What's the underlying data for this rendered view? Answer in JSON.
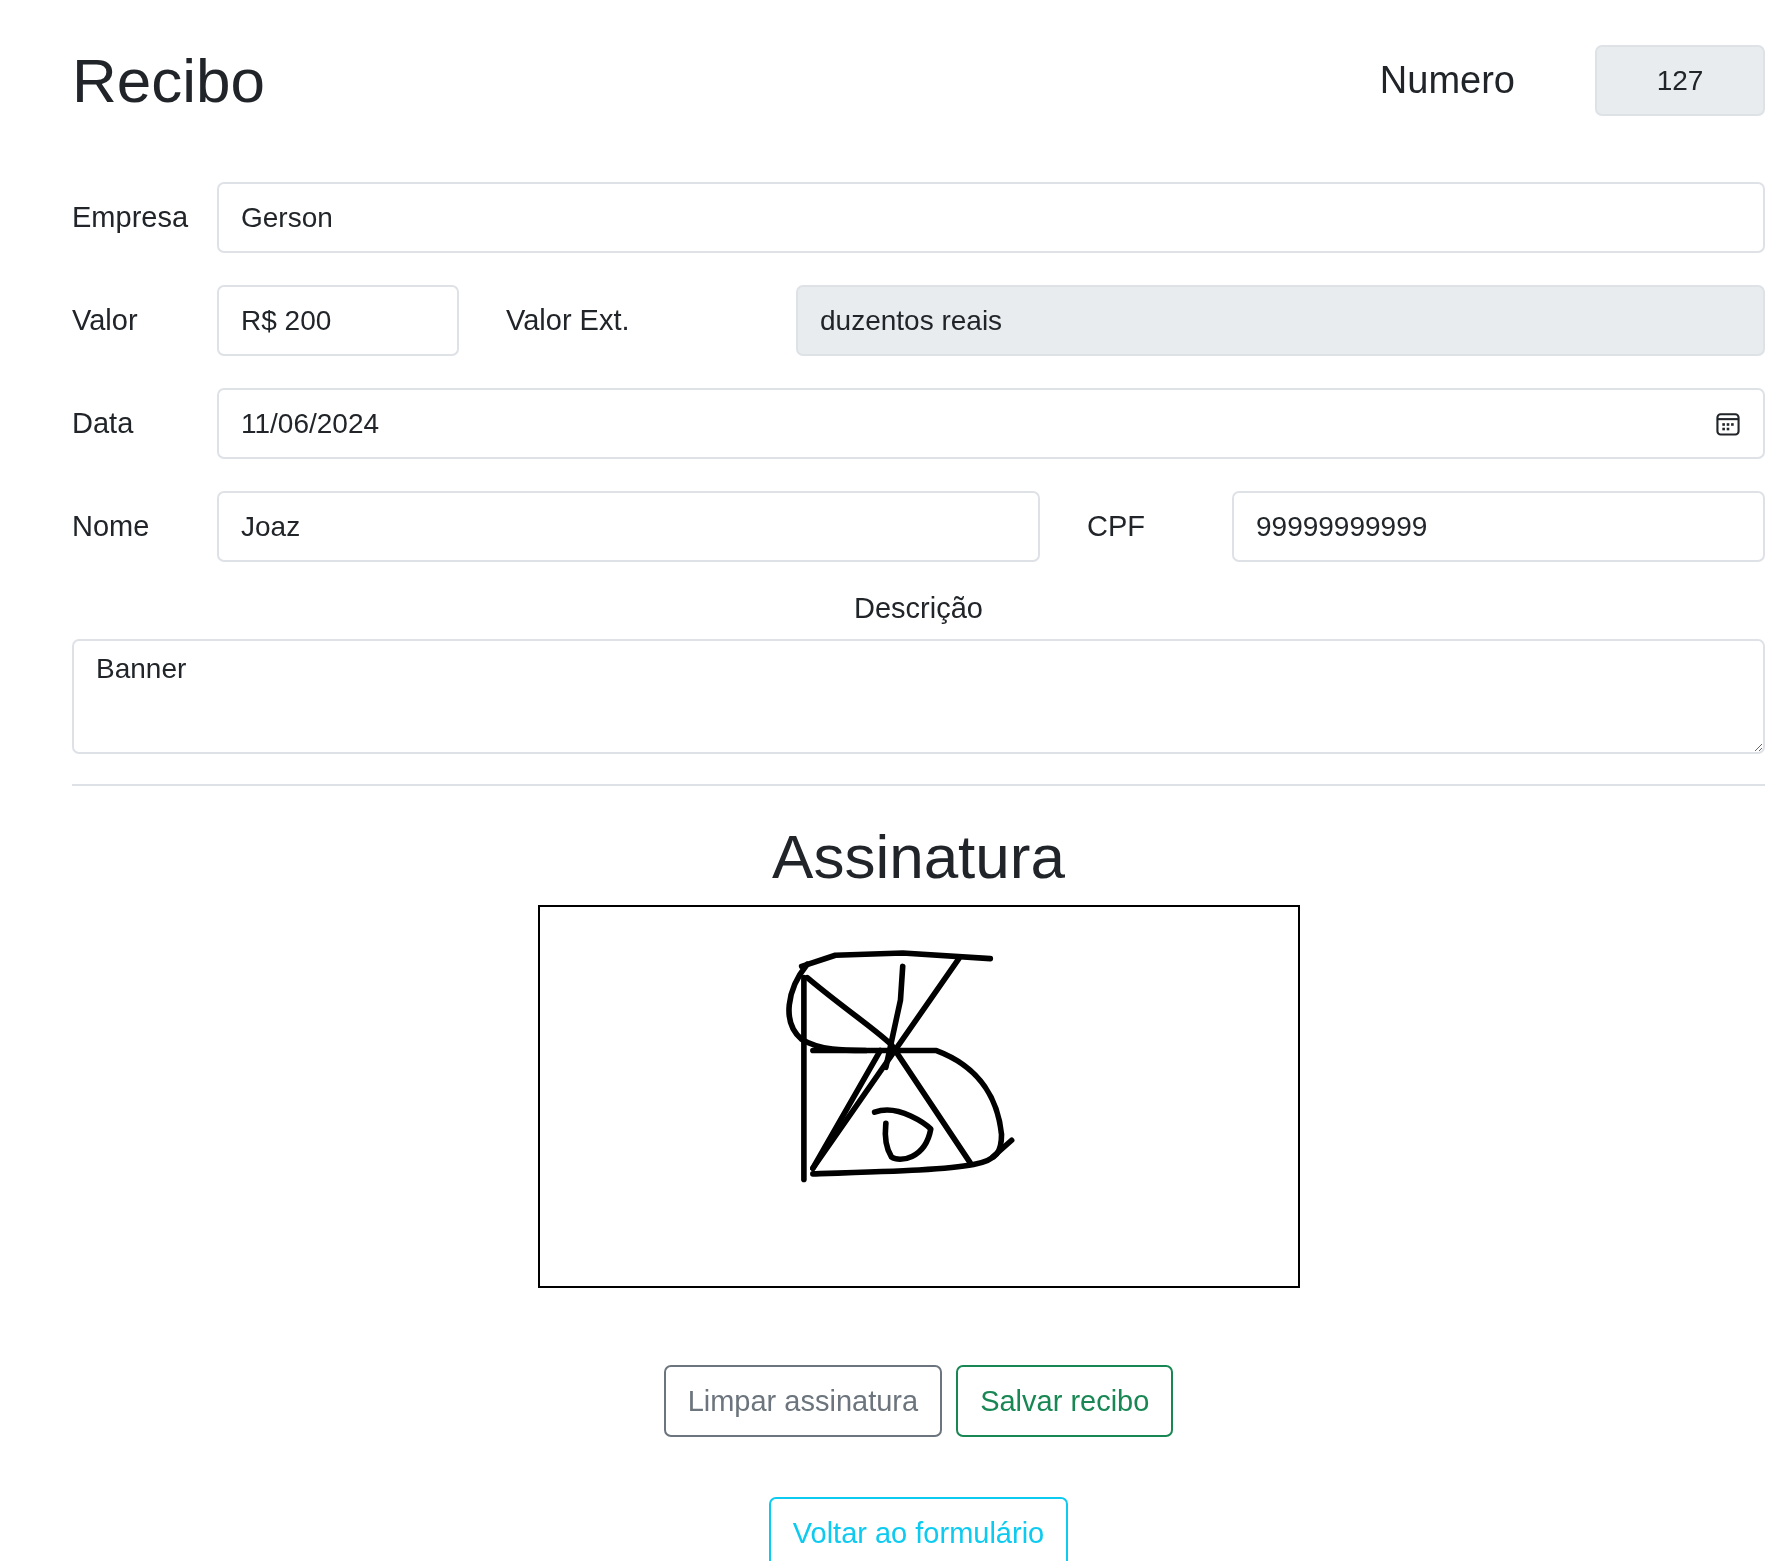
{
  "title": "Recibo",
  "numero": {
    "label": "Numero",
    "value": "127",
    "kind": "readonly"
  },
  "rows": [
    [
      {
        "label": "Empresa",
        "value": "Gerson",
        "kind": "text"
      }
    ],
    [
      {
        "label": "Valor",
        "value": "R$ 200",
        "kind": "text"
      },
      {
        "label": "Valor Ext.",
        "value": "duzentos reais",
        "kind": "readonly"
      }
    ],
    [
      {
        "label": "Data",
        "value": "11/06/2024",
        "kind": "date"
      }
    ],
    [
      {
        "label": "Nome",
        "value": "Joaz",
        "kind": "text"
      },
      {
        "label": "CPF",
        "value": "99999999999",
        "kind": "text"
      }
    ]
  ],
  "descricao": {
    "label": "Descrição",
    "value": "Banner"
  },
  "assinatura": {
    "title": "Assinatura"
  },
  "buttons": [
    {
      "label": "Limpar assinatura",
      "kind": "secondary"
    },
    {
      "label": "Salvar recibo",
      "kind": "success"
    }
  ],
  "back_button": {
    "label": "Voltar ao formulário",
    "kind": "info"
  }
}
